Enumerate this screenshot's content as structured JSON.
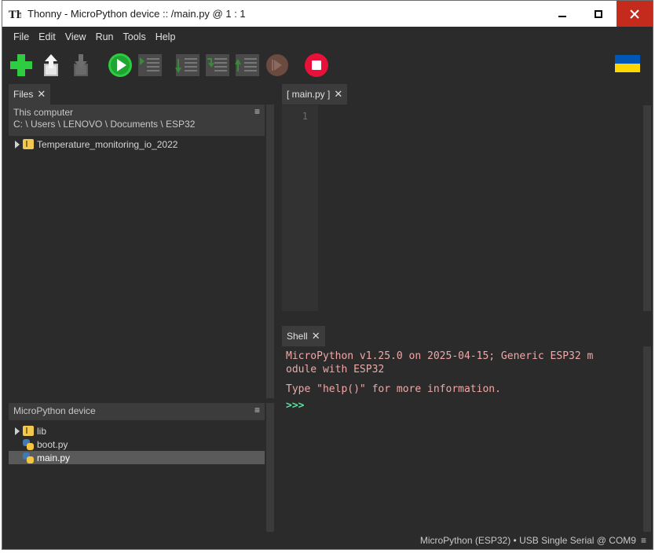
{
  "window": {
    "title": "Thonny  -  MicroPython device :: /main.py  @  1 : 1",
    "controls": {
      "minimize": "–",
      "maximize": "▢",
      "close": "✕"
    }
  },
  "menu": [
    "File",
    "Edit",
    "View",
    "Run",
    "Tools",
    "Help"
  ],
  "toolbar": {
    "icons": [
      "new-file-icon",
      "open-file-icon",
      "save-file-icon",
      "run-icon",
      "debug-icon",
      "step-over-icon",
      "step-into-icon",
      "step-out-icon",
      "resume-icon",
      "stop-icon",
      "ukraine-flag-icon"
    ],
    "colors": {
      "new": "#2ecc40",
      "run": "#2ecc40",
      "stop": "#e8113a",
      "flag_blue": "#0057b7",
      "flag_yellow": "#ffd700"
    }
  },
  "files_panel": {
    "tab_label": "Files",
    "computer": {
      "heading": "This computer",
      "path": "C: \\ Users \\ LENOVO \\ Documents \\ ESP32",
      "items": [
        {
          "name": "Temperature_monitoring_io_2022",
          "type": "folder"
        }
      ]
    },
    "device": {
      "heading": "MicroPython device",
      "items": [
        {
          "name": "lib",
          "type": "folder"
        },
        {
          "name": "boot.py",
          "type": "python"
        },
        {
          "name": "main.py",
          "type": "python",
          "selected": true
        }
      ]
    },
    "menu_glyph": "≡"
  },
  "editor": {
    "tab_label": "[ main.py ]",
    "line_numbers": [
      "1"
    ]
  },
  "shell": {
    "tab_label": "Shell",
    "lines": [
      "MicroPython v1.25.0 on 2025-04-15; Generic ESP32 m",
      "odule with ESP32",
      "Type \"help()\" for more information."
    ],
    "prompt": ">>>"
  },
  "status": {
    "text": "MicroPython (ESP32)  •  USB Single Serial @ COM9",
    "menu_glyph": "≡"
  }
}
